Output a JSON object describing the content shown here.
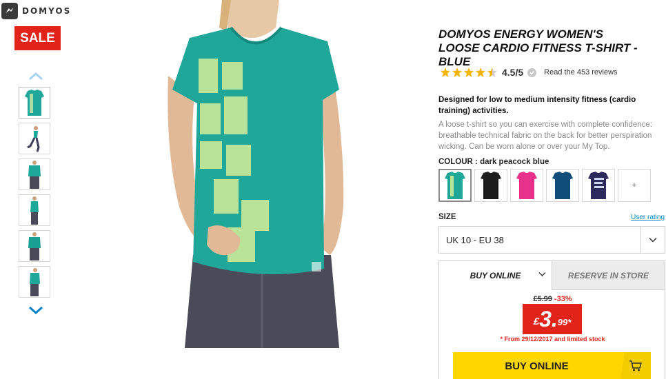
{
  "brand": {
    "name": "DOMYOS"
  },
  "sale_badge": "SALE",
  "product": {
    "title": "DOMYOS ENERGY WOMEN'S LOOSE CARDIO FITNESS T-SHIRT - BLUE",
    "rating": 4.5,
    "rating_text": "4.5/5",
    "reviews_link": "Read the 453 reviews",
    "description_bold": "Designed for low to medium intensity fitness (cardio training) activities.",
    "description": "A loose t-shirt so you can exercise with complete confidence: breathable technical fabric on the back for better perspiration wicking. Can be worn alone or over your My Top."
  },
  "colour": {
    "label": "COLOUR : ",
    "value": "dark peacock blue",
    "swatches": [
      {
        "name": "dark peacock blue",
        "color": "#1fa79a",
        "selected": true
      },
      {
        "name": "black",
        "color": "#1d1d1d",
        "selected": false
      },
      {
        "name": "pink",
        "color": "#e8318a",
        "selected": false
      },
      {
        "name": "navy",
        "color": "#0f4d7a",
        "selected": false
      },
      {
        "name": "purple print",
        "color": "#2c2a5c",
        "selected": false
      }
    ],
    "more_label": "+"
  },
  "size": {
    "label": "SIZE",
    "user_rating_link": "User rating",
    "selected": "UK 10 - EU 38"
  },
  "purchase": {
    "tab_online": "BUY ONLINE",
    "tab_store": "RESERVE IN STORE",
    "old_price": "£5.99",
    "discount": "-33%",
    "price_currency": "£",
    "price_whole": "3.",
    "price_decimal": "99*",
    "price_note": "* From 29/12/2017 and limited stock",
    "buy_button": "BUY ONLINE"
  },
  "colors": {
    "accent_red": "#e2231a",
    "buy_yellow": "#ffd700",
    "link_blue": "#0082c3",
    "shirt_teal": "#1fa79a"
  }
}
